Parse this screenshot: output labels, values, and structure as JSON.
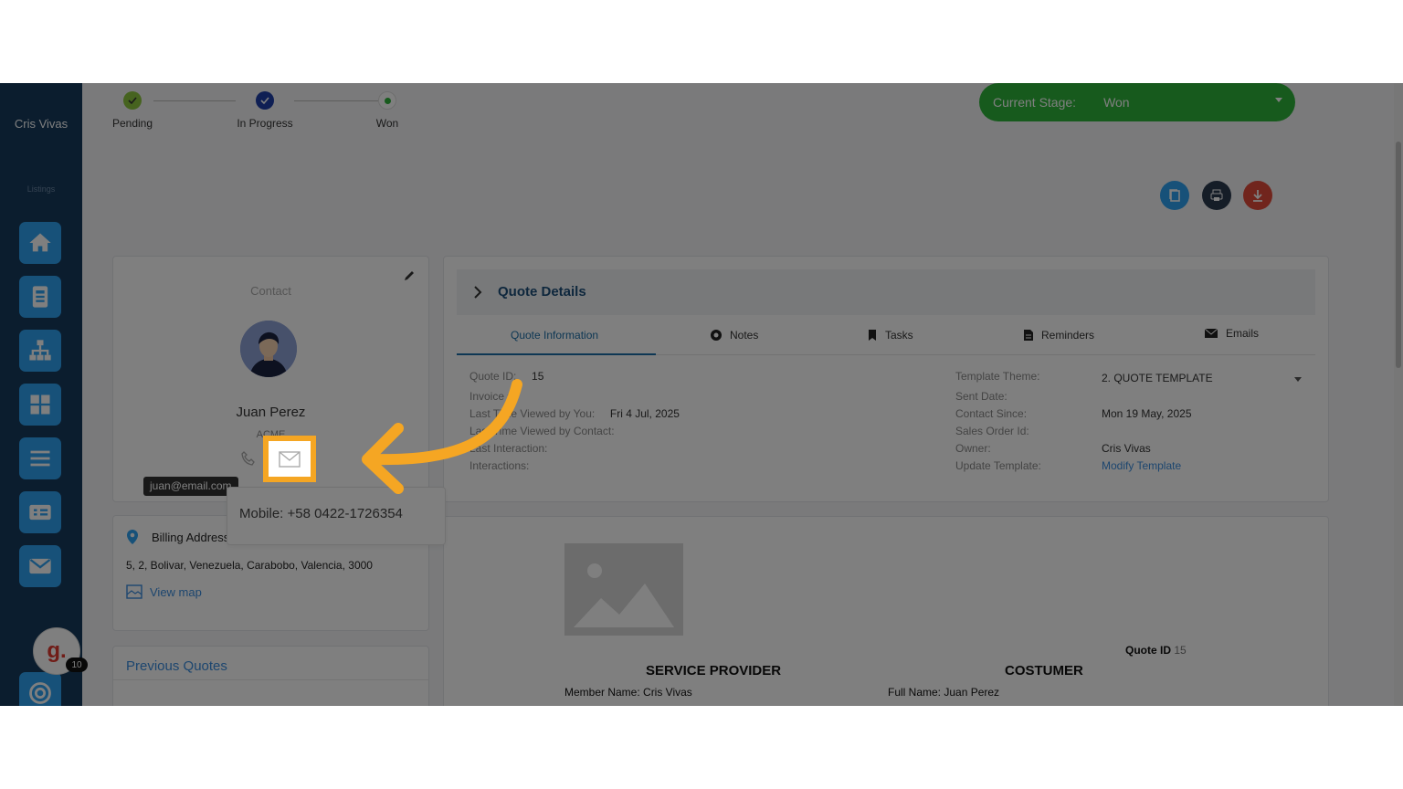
{
  "sidebar": {
    "user_name": "Cris Vivas",
    "section_label": "Listings",
    "nav": [
      {
        "icon": "home-icon"
      },
      {
        "icon": "contact-card-icon"
      },
      {
        "icon": "org-chart-icon"
      },
      {
        "icon": "grid-icon"
      },
      {
        "icon": "list-icon"
      },
      {
        "icon": "invoice-icon"
      },
      {
        "icon": "mail-icon"
      },
      {
        "icon": "target-icon"
      }
    ],
    "g_avatar_letter": "g.",
    "g_badge_count": "10"
  },
  "stepper": {
    "steps": [
      {
        "label": "Pending",
        "state": "done"
      },
      {
        "label": "In Progress",
        "state": "current"
      },
      {
        "label": "Won",
        "state": "upcoming"
      }
    ]
  },
  "stage": {
    "label": "Current Stage:",
    "value": "Won",
    "color": "#2fb53a"
  },
  "contact": {
    "title": "Contact",
    "name": "Juan Perez",
    "company": "ACME",
    "email_tooltip": "juan@email.com",
    "mobile_popover": "Mobile:  +58 0422-1726354"
  },
  "billing": {
    "title": "Billing Address",
    "address": "5, 2, Bolivar, Venezuela, Carabobo, Valencia, 3000",
    "view_map": "View map"
  },
  "previous_quotes": {
    "title": "Previous Quotes"
  },
  "quote_details": {
    "title": "Quote Details",
    "tabs": [
      "Quote Information",
      "Notes",
      "Tasks",
      "Reminders",
      "Emails"
    ],
    "left": {
      "quote_id_label": "Quote ID:",
      "quote_id_value": "15",
      "invoice_label": "Invoice #:",
      "last_viewed_you_label": "Last Time Viewed by You:",
      "last_viewed_you_value": "Fri 4 Jul, 2025",
      "last_viewed_contact_label": "Last Time Viewed by Contact:",
      "last_interaction_label": "Last Interaction:",
      "interactions_label": "Interactions:"
    },
    "right": {
      "template_theme_label": "Template Theme:",
      "template_theme_value": "2. QUOTE TEMPLATE",
      "sent_date_label": "Sent Date:",
      "contact_since_label": "Contact Since:",
      "contact_since_value": "Mon 19 May, 2025",
      "sales_order_label": "Sales Order Id:",
      "owner_label": "Owner:",
      "owner_value": "Cris Vivas",
      "update_template_label": "Update Template:",
      "modify_template": "Modify Template"
    }
  },
  "preview": {
    "service_provider": "SERVICE PROVIDER",
    "customer": "COSTUMER",
    "quote_id_label": "Quote ID",
    "quote_id_value": "15",
    "member_name": "Member Name:  Cris Vivas",
    "full_name": "Full Name:  Juan Perez"
  }
}
